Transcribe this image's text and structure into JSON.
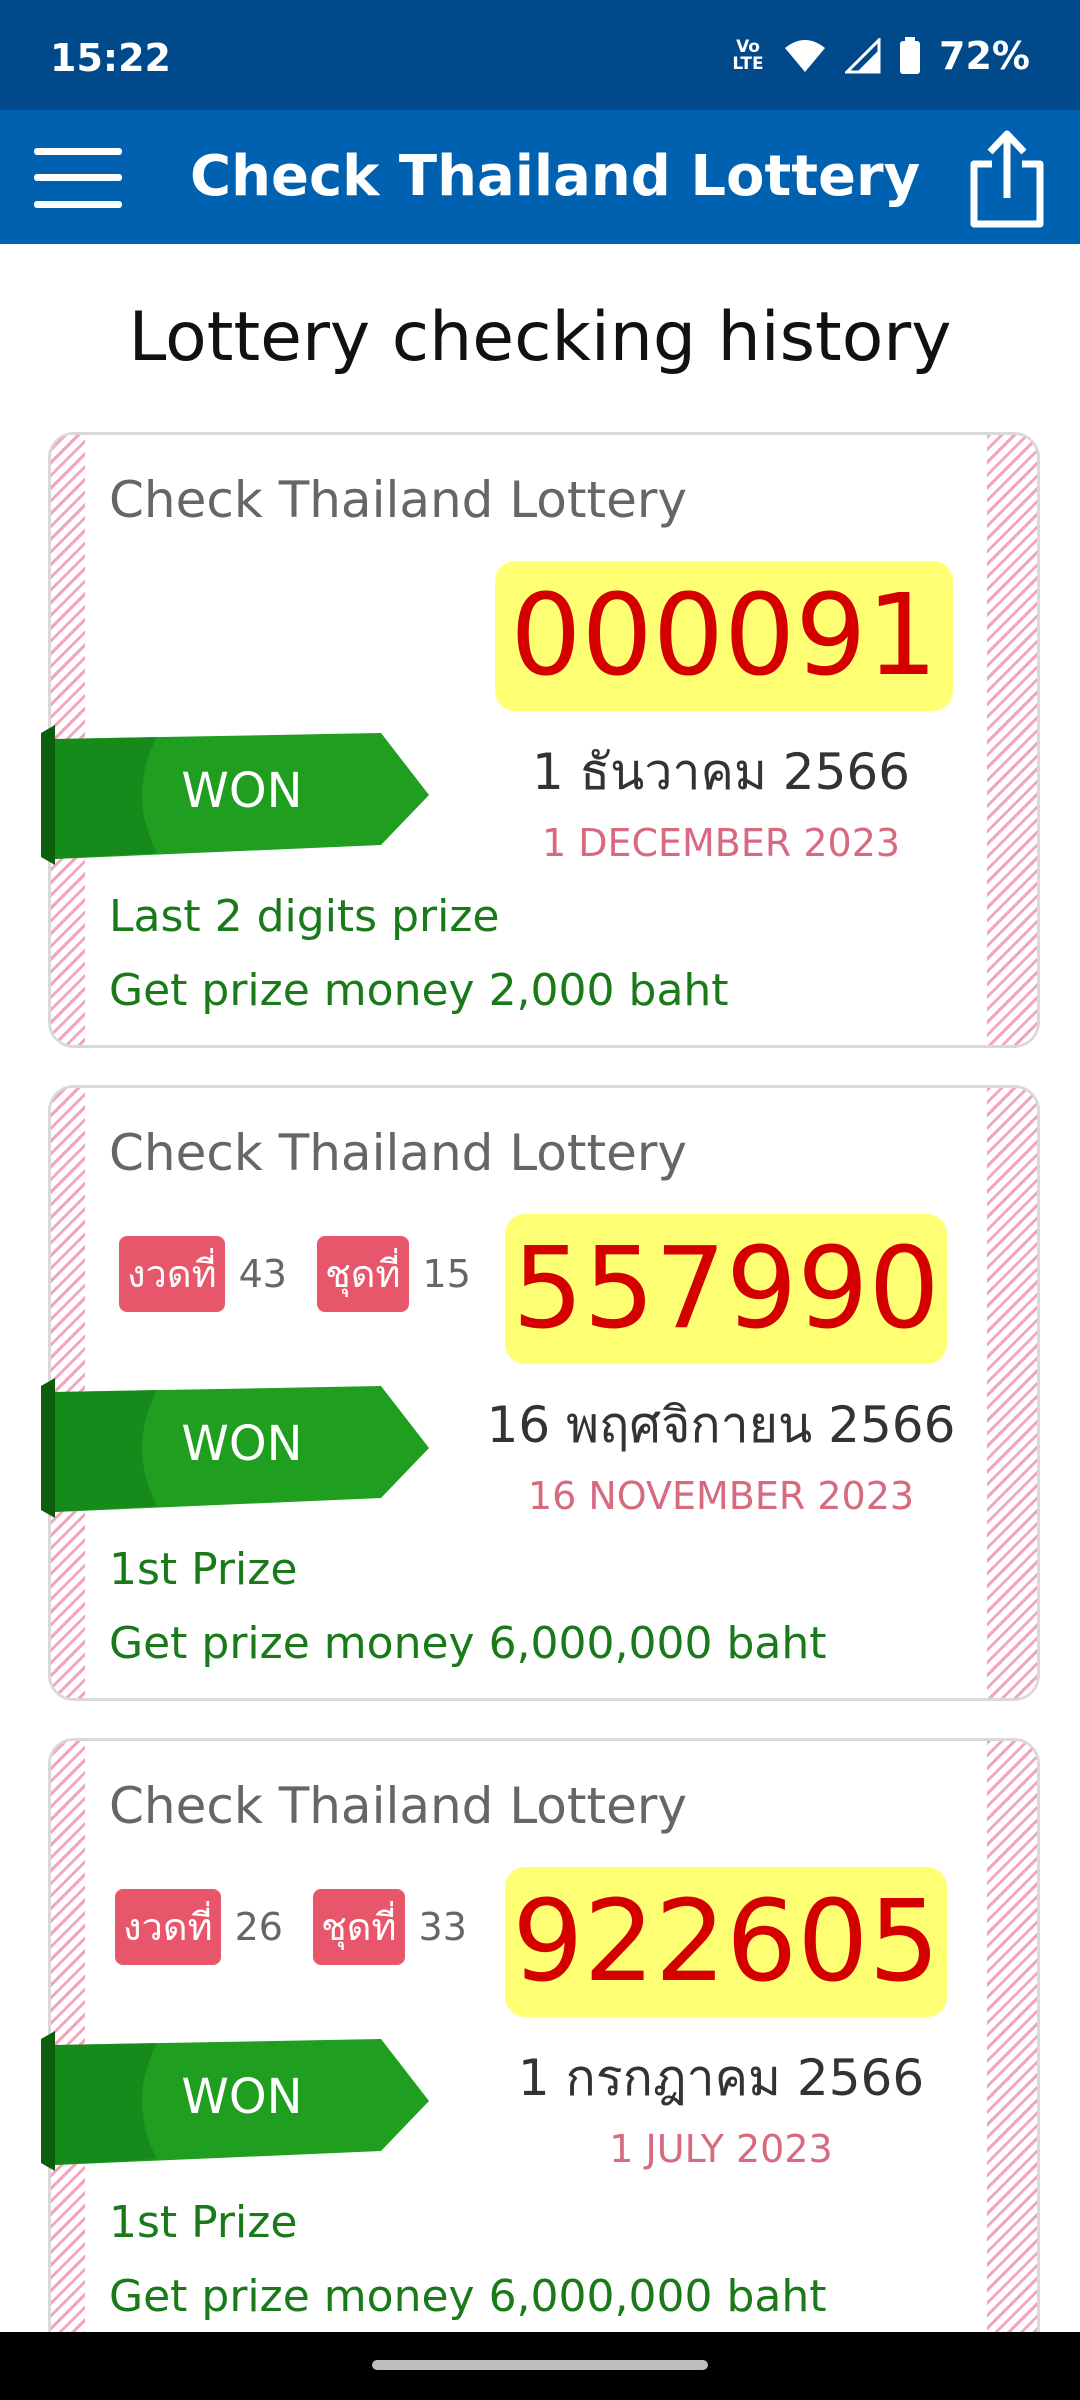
{
  "status_bar": {
    "time": "15:22",
    "network_label": "Vo LTE",
    "battery": "72%"
  },
  "app_bar": {
    "title": "Check Thailand Lottery",
    "menu_icon": "hamburger-menu-icon",
    "share_icon": "share-icon"
  },
  "page_title": "Lottery checking history",
  "cards": [
    {
      "brand": "Check Thailand Lottery",
      "number": "000091",
      "thai_date": "1 ธันวาคม 2566",
      "english_date": "1 DECEMBER 2023",
      "status": "WON",
      "prize_name": "Last 2 digits prize",
      "prize_money": "Get prize money 2,000 baht"
    },
    {
      "brand": "Check Thailand Lottery",
      "draw_label": "งวดที่",
      "draw_number": "43",
      "set_label": "ชุดที่",
      "set_number": "15",
      "number": "557990",
      "thai_date": "16 พฤศจิกายน 2566",
      "english_date": "16 NOVEMBER 2023",
      "status": "WON",
      "prize_name": "1st Prize",
      "prize_money": "Get prize money 6,000,000 baht"
    },
    {
      "brand": "Check Thailand Lottery",
      "draw_label": "งวดที่",
      "draw_number": "26",
      "set_label": "ชุดที่",
      "set_number": "33",
      "number": "922605",
      "thai_date": "1 กรกฎาคม 2566",
      "english_date": "1 JULY 2023",
      "status": "WON",
      "prize_name": "1st Prize",
      "prize_money": "Get prize money 6,000,000 baht"
    }
  ],
  "colors": {
    "status_bar": "#004a8c",
    "app_bar": "#0061b0",
    "number_bg": "#ffff73",
    "number_text": "#d40000",
    "won_ribbon": "#1f9e1f",
    "prize_text": "#1a7a1a",
    "english_date": "#d86a80",
    "draw_badge": "#e8566b"
  }
}
